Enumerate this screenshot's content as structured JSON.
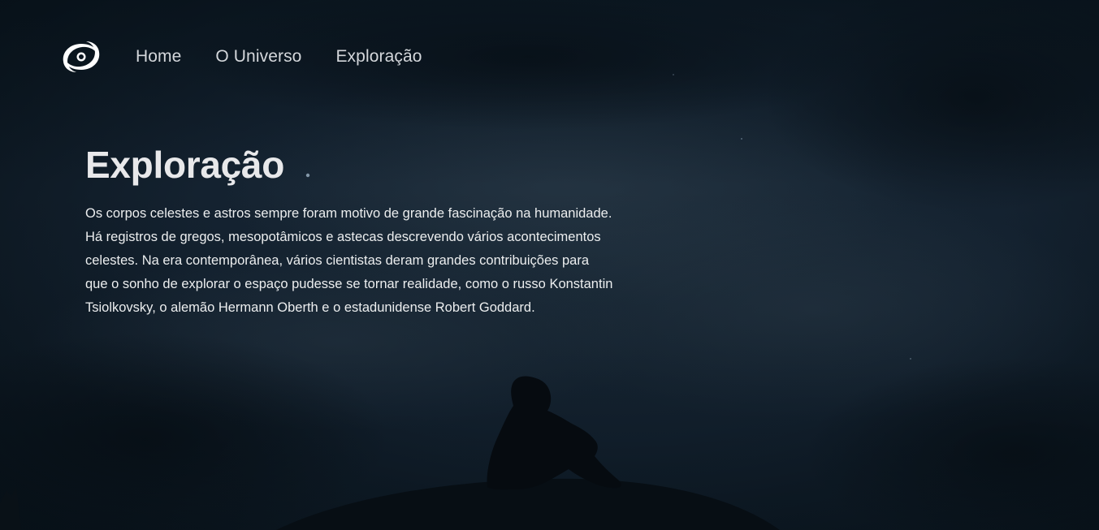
{
  "nav": {
    "logo_icon": "spiral-galaxy-icon",
    "items": [
      {
        "label": "Home"
      },
      {
        "label": "O Universo"
      },
      {
        "label": "Exploração"
      }
    ]
  },
  "main": {
    "title": "Exploração",
    "paragraph": "Os corpos celestes e astros sempre foram motivo de grande fascinação na humanidade. Há registros de gregos, mesopotâmicos e astecas descrevendo vários acontecimentos celestes. Na era contemporânea, vários cientistas deram grandes contribuições para que o sonho de explorar o espaço pudesse se tornar realidade, como o russo Konstantin Tsiolkovsky, o alemão Hermann Oberth e o estadunidense Robert Goddard."
  },
  "colors": {
    "background": "#0b1620",
    "text": "#eceeef",
    "nav_text": "#d4d7db"
  }
}
